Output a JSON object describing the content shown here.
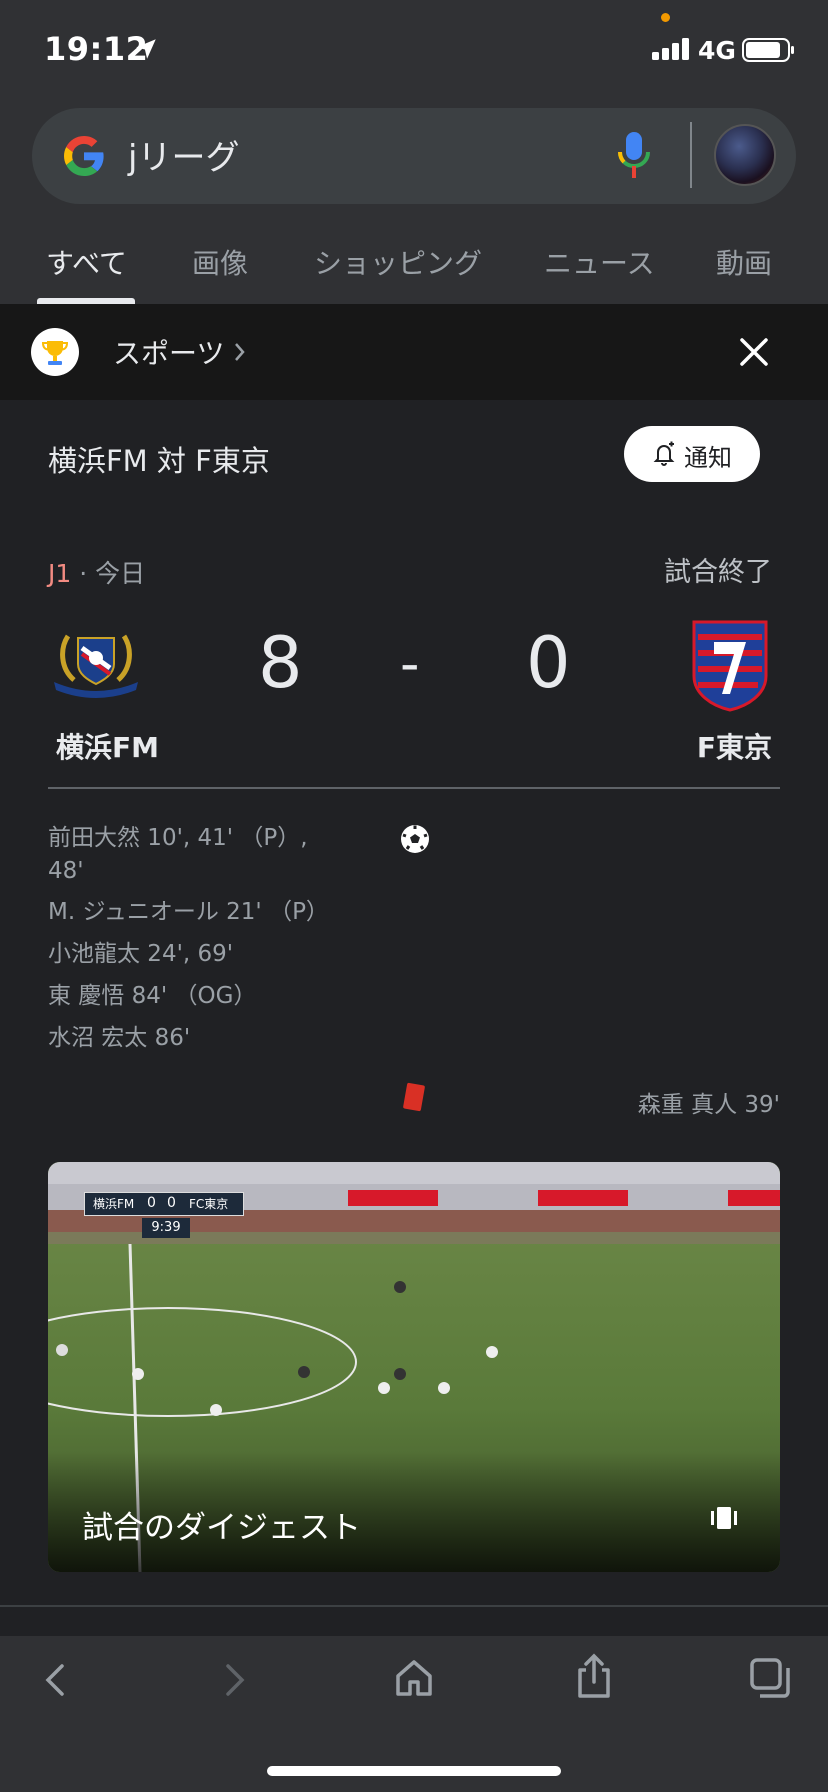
{
  "status_bar": {
    "time": "19:12",
    "network": "4G"
  },
  "search": {
    "query": "jリーグ"
  },
  "tabs": [
    {
      "label": "すべて",
      "active": true
    },
    {
      "label": "画像",
      "active": false
    },
    {
      "label": "ショッピング",
      "active": false
    },
    {
      "label": "ニュース",
      "active": false
    },
    {
      "label": "動画",
      "active": false
    }
  ],
  "sports_bar": {
    "label": "スポーツ"
  },
  "match": {
    "title": "横浜FM 対 F東京",
    "notify_label": "通知",
    "league": "J1",
    "date": " · 今日",
    "status": "試合終了",
    "home": {
      "name": "横浜FM",
      "score": "8"
    },
    "away": {
      "name": "F東京",
      "score": "0"
    },
    "separator": "-",
    "goals": [
      "前田大然 10', 41' （P）,",
      "48'",
      "M. ジュニオール 21' （P）",
      "小池龍太 24', 69'",
      "東 慶悟 84' （OG）",
      "水沼 宏太 86'"
    ],
    "red_card": "森重 真人 39'"
  },
  "video": {
    "title": "試合のダイジェスト",
    "overlay": {
      "home": "横浜FM",
      "home_score": "0",
      "away_score": "0",
      "away": "FC東京",
      "clock": "9:39"
    }
  },
  "colors": {
    "background": "#202124",
    "surface": "#303134",
    "accent_red": "#f28b82",
    "card_red": "#d93025"
  }
}
